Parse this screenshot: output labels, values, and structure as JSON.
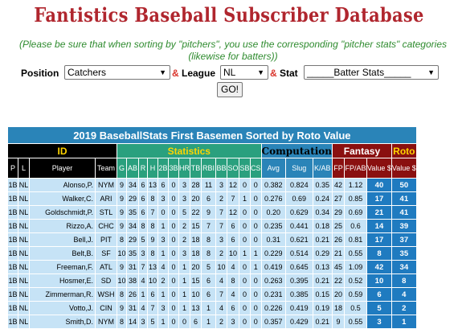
{
  "header": {
    "title": "Fantistics Baseball Subscriber Database",
    "note": "(Please be sure that when sorting by \"pitchers\", you use the corresponding \"pitcher stats\" categories (likewise for batters))"
  },
  "controls": {
    "position_label": "Position",
    "position_value": "Catchers",
    "amp": "&",
    "league_label": "League",
    "league_value": "NL",
    "stat_label": "Stat",
    "stat_value": "_____Batter Stats_____",
    "go_label": "GO!"
  },
  "table": {
    "caption": "2019 BaseballStats First Basemen Sorted by Roto Value",
    "groups": {
      "id": "ID",
      "statistics": "Statistics",
      "computation": "Computation",
      "fantasy": "Fantasy",
      "roto": "Roto"
    },
    "columns": [
      "P",
      "L",
      "Player",
      "Team",
      "G",
      "AB",
      "R",
      "H",
      "2B",
      "3B",
      "HR",
      "TB",
      "RBI",
      "BB",
      "SO",
      "SB",
      "CS",
      "Avg",
      "Slug",
      "K/AB",
      "FP",
      "FP/AB",
      "Value $",
      "Value $"
    ],
    "rows": [
      [
        "1B",
        "NL",
        "Alonso,P.",
        "NYM",
        "9",
        "34",
        "6",
        "13",
        "6",
        "0",
        "3",
        "28",
        "11",
        "3",
        "12",
        "0",
        "0",
        "0.382",
        "0.824",
        "0.35",
        "42",
        "1.12",
        "40",
        "50"
      ],
      [
        "1B",
        "NL",
        "Walker,C.",
        "ARI",
        "9",
        "29",
        "6",
        "8",
        "3",
        "0",
        "3",
        "20",
        "6",
        "2",
        "7",
        "1",
        "0",
        "0.276",
        "0.69",
        "0.24",
        "27",
        "0.85",
        "17",
        "41"
      ],
      [
        "1B",
        "NL",
        "Goldschmidt,P.",
        "STL",
        "9",
        "35",
        "6",
        "7",
        "0",
        "0",
        "5",
        "22",
        "9",
        "7",
        "12",
        "0",
        "0",
        "0.20",
        "0.629",
        "0.34",
        "29",
        "0.69",
        "21",
        "41"
      ],
      [
        "1B",
        "NL",
        "Rizzo,A.",
        "CHC",
        "9",
        "34",
        "8",
        "8",
        "1",
        "0",
        "2",
        "15",
        "7",
        "7",
        "6",
        "0",
        "0",
        "0.235",
        "0.441",
        "0.18",
        "25",
        "0.6",
        "14",
        "39"
      ],
      [
        "1B",
        "NL",
        "Bell,J.",
        "PIT",
        "8",
        "29",
        "5",
        "9",
        "3",
        "0",
        "2",
        "18",
        "8",
        "3",
        "6",
        "0",
        "0",
        "0.31",
        "0.621",
        "0.21",
        "26",
        "0.81",
        "17",
        "37"
      ],
      [
        "1B",
        "NL",
        "Belt,B.",
        "SF",
        "10",
        "35",
        "3",
        "8",
        "1",
        "0",
        "3",
        "18",
        "8",
        "2",
        "10",
        "1",
        "1",
        "0.229",
        "0.514",
        "0.29",
        "21",
        "0.55",
        "8",
        "35"
      ],
      [
        "1B",
        "NL",
        "Freeman,F.",
        "ATL",
        "9",
        "31",
        "7",
        "13",
        "4",
        "0",
        "1",
        "20",
        "5",
        "10",
        "4",
        "0",
        "1",
        "0.419",
        "0.645",
        "0.13",
        "45",
        "1.09",
        "42",
        "34"
      ],
      [
        "1B",
        "NL",
        "Hosmer,E.",
        "SD",
        "10",
        "38",
        "4",
        "10",
        "2",
        "0",
        "1",
        "15",
        "6",
        "4",
        "8",
        "0",
        "0",
        "0.263",
        "0.395",
        "0.21",
        "22",
        "0.52",
        "10",
        "8"
      ],
      [
        "1B",
        "NL",
        "Zimmerman,R.",
        "WSH",
        "8",
        "26",
        "1",
        "6",
        "1",
        "0",
        "1",
        "10",
        "6",
        "7",
        "4",
        "0",
        "0",
        "0.231",
        "0.385",
        "0.15",
        "20",
        "0.59",
        "6",
        "4"
      ],
      [
        "1B",
        "NL",
        "Votto,J.",
        "CIN",
        "9",
        "31",
        "4",
        "7",
        "3",
        "0",
        "1",
        "13",
        "1",
        "4",
        "6",
        "0",
        "0",
        "0.226",
        "0.419",
        "0.19",
        "18",
        "0.5",
        "5",
        "2"
      ],
      [
        "1B",
        "NL",
        "Smith,D.",
        "NYM",
        "8",
        "14",
        "3",
        "5",
        "1",
        "0",
        "0",
        "6",
        "1",
        "2",
        "3",
        "0",
        "0",
        "0.357",
        "0.429",
        "0.21",
        "9",
        "0.55",
        "3",
        "1"
      ]
    ]
  }
}
